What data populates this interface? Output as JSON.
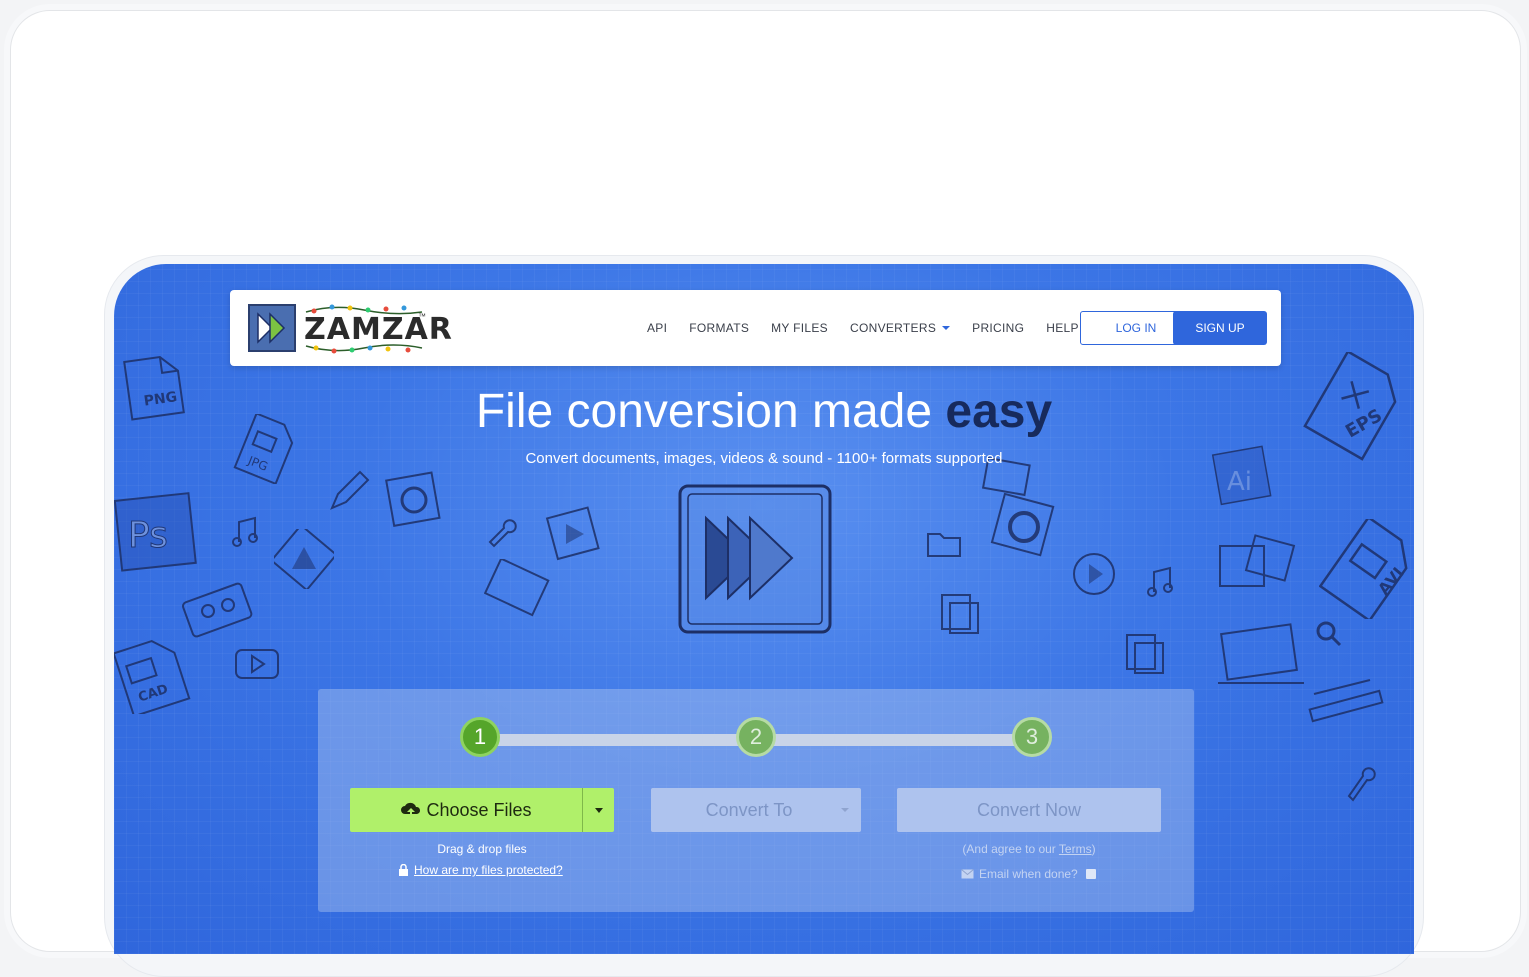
{
  "brand": {
    "name": "ZAMZAR",
    "tm": "™"
  },
  "nav": {
    "items": [
      {
        "label": "API"
      },
      {
        "label": "FORMATS"
      },
      {
        "label": "MY FILES"
      },
      {
        "label": "CONVERTERS",
        "has_dropdown": true
      },
      {
        "label": "PRICING"
      },
      {
        "label": "HELP"
      }
    ],
    "login_label": "LOG IN",
    "signup_label": "SIGN UP"
  },
  "hero": {
    "title_main": "File conversion made ",
    "title_emphasis": "easy",
    "subtitle": "Convert documents, images, videos & sound - 1100+ formats supported"
  },
  "decor_labels": {
    "png": "PNG",
    "jpg": "JPG",
    "ps": "Ps",
    "cad": "CAD",
    "eps": "EPS",
    "ai": "Ai",
    "avi": "AVI"
  },
  "converter": {
    "steps": [
      "1",
      "2",
      "3"
    ],
    "active_step": 1,
    "choose_files_label": "Choose Files",
    "drag_drop_text": "Drag & drop files",
    "protected_link": "How are my files protected?",
    "convert_to_label": "Convert To",
    "convert_now_label": "Convert Now",
    "agree_prefix": "(And agree to our ",
    "terms_link": "Terms",
    "agree_suffix": ")",
    "email_label": "Email when done?"
  },
  "colors": {
    "primary": "#2f66dc",
    "accent_green": "#b0f06a",
    "step_active": "#55a52a",
    "title_emphasis": "#172a5c"
  }
}
